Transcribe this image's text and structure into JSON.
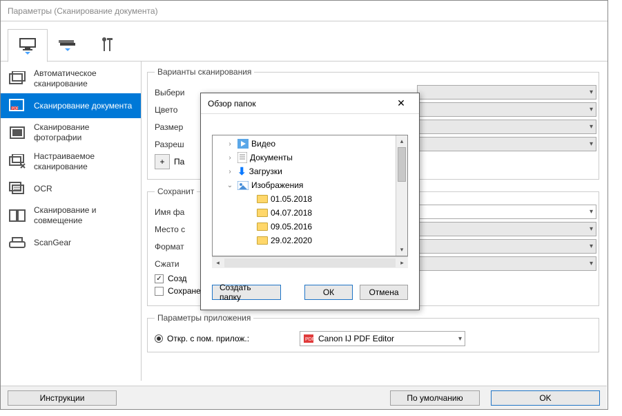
{
  "window": {
    "title": "Параметры (Сканирование документа)"
  },
  "sidebar": {
    "items": [
      {
        "label": "Автоматическое сканирование"
      },
      {
        "label": "Сканирование документа"
      },
      {
        "label": "Сканирование фотографии"
      },
      {
        "label": "Настраиваемое сканирование"
      },
      {
        "label": "OCR"
      },
      {
        "label": "Сканирование и совмещение"
      },
      {
        "label": "ScanGear"
      }
    ]
  },
  "scan_options": {
    "legend": "Варианты сканирования",
    "select_label": "Выбери",
    "color_label": "Цвето",
    "size_label": "Размер",
    "resolution_label": "Разреш",
    "params_label": "Па"
  },
  "save_options": {
    "legend": "Сохранит",
    "filename_label": "Имя фа",
    "location_label": "Место с",
    "format_label": "Формат",
    "compress_label": "Сжати",
    "check_create": "Созд",
    "check_subfolder": "Сохранение в подпапку с текущей датой"
  },
  "app_options": {
    "legend": "Параметры приложения",
    "radio_label": "Откр. с пом. прилож.:",
    "app_name": "Canon IJ PDF Editor"
  },
  "footer": {
    "instructions": "Инструкции",
    "defaults": "По умолчанию",
    "ok": "OK"
  },
  "dialog": {
    "title": "Обзор папок",
    "create_folder": "Создать папку",
    "ok": "ОК",
    "cancel": "Отмена",
    "tree": [
      {
        "indent": 0,
        "expander": "›",
        "icon": "video",
        "label": "Видео"
      },
      {
        "indent": 0,
        "expander": "›",
        "icon": "doc",
        "label": "Документы"
      },
      {
        "indent": 0,
        "expander": "›",
        "icon": "dl",
        "label": "Загрузки"
      },
      {
        "indent": 0,
        "expander": "⌄",
        "icon": "img",
        "label": "Изображения"
      },
      {
        "indent": 1,
        "expander": "",
        "icon": "folder",
        "label": "01.05.2018"
      },
      {
        "indent": 1,
        "expander": "",
        "icon": "folder",
        "label": "04.07.2018"
      },
      {
        "indent": 1,
        "expander": "",
        "icon": "folder",
        "label": "09.05.2016"
      },
      {
        "indent": 1,
        "expander": "",
        "icon": "folder",
        "label": "29.02.2020"
      }
    ]
  }
}
